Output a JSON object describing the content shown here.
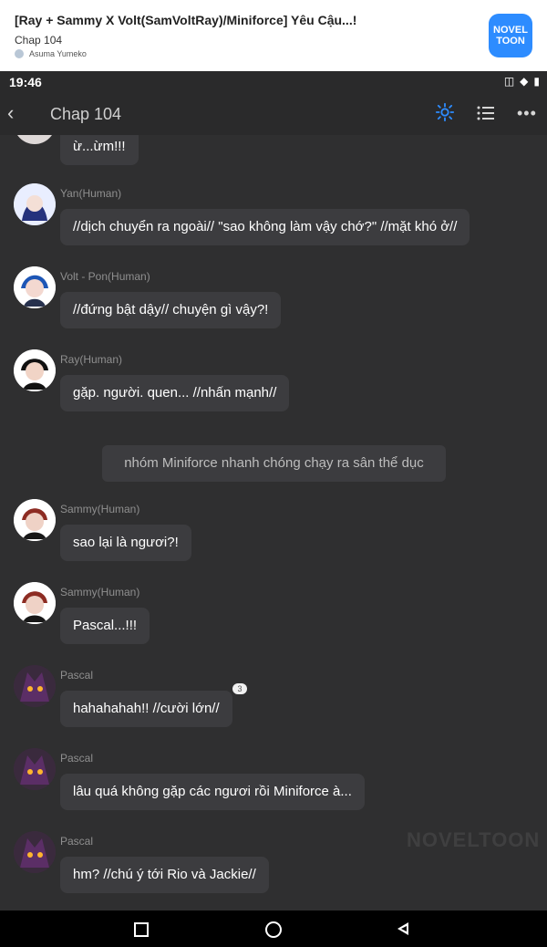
{
  "banner": {
    "title": "[Ray + Sammy X Volt(SamVoltRay)/Miniforce] Yêu Cậu...!",
    "chapter": "Chap 104",
    "author": "Asuma Yumeko",
    "logo_line1": "NOVEL",
    "logo_line2": "TOON"
  },
  "status_bar": {
    "time": "19:46",
    "icons": [
      "vibrate-icon",
      "wifi-icon",
      "battery-icon"
    ]
  },
  "app_bar": {
    "title": "Chap 104",
    "icons": [
      "back-icon",
      "settings-icon",
      "list-icon",
      "more-icon"
    ]
  },
  "messages": [
    {
      "speaker": "",
      "text": "ừ...ừm!!!"
    },
    {
      "speaker": "Yan(Human)",
      "text": "//dịch chuyển ra ngoài// \"sao không làm vậy chớ?\" //mặt khó ở//"
    },
    {
      "speaker": "Volt - Pon(Human)",
      "text": "//đứng bật dậy// chuyện gì vậy?!"
    },
    {
      "speaker": "Ray(Human)",
      "text": "gặp. người. quen... //nhấn mạnh//"
    },
    {
      "speaker": "Sammy(Human)",
      "text": "sao lại là ngươi?!"
    },
    {
      "speaker": "Sammy(Human)",
      "text": "Pascal...!!!"
    },
    {
      "speaker": "Pascal",
      "text": "hahahahah!! //cười lớn//"
    },
    {
      "speaker": "Pascal",
      "text": "lâu quá không gặp các ngươi rồi Miniforce à..."
    },
    {
      "speaker": "Pascal",
      "text": "hm? //chú ý tới Rio và Jackie//"
    }
  ],
  "system_message": "nhóm Miniforce nhanh chóng chạy ra sân thể dục",
  "badge_count": "3",
  "watermark": "NOVELTOON",
  "colors": {
    "background": "#2f2f30",
    "bubble": "#3c3c3f",
    "accent": "#2d8cff",
    "name": "#8f8f8f"
  }
}
